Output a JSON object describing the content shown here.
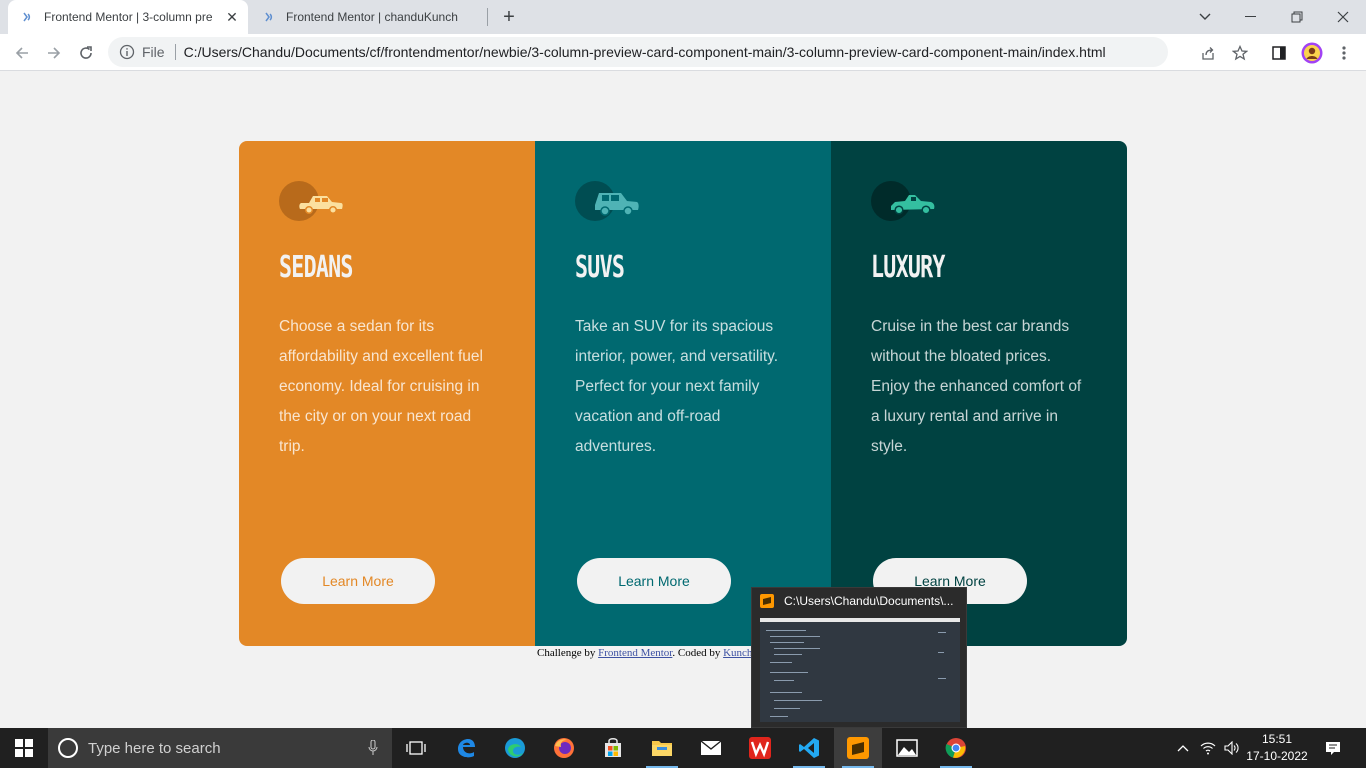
{
  "browser": {
    "tabs": [
      {
        "title": "Frontend Mentor | 3-column pre"
      },
      {
        "title": "Frontend Mentor | chanduKunch"
      }
    ],
    "url_scheme": "File",
    "url": "C:/Users/Chandu/Documents/cf/frontendmentor/newbie/3-column-preview-card-component-main/3-column-preview-card-component-main/index.html"
  },
  "cards": [
    {
      "title": "SEDANS",
      "text": "Choose a sedan for its affordability and excellent fuel economy. Ideal for cruising in the city or on your next road trip.",
      "button": "Learn More",
      "color": "#e38826",
      "icon": "sedan-icon"
    },
    {
      "title": "SUVS",
      "text": "Take an SUV for its spacious interior, power, and versatility. Perfect for your next family vacation and off-road adventures.",
      "button": "Learn More",
      "color": "#006970",
      "icon": "suv-icon"
    },
    {
      "title": "LUXURY",
      "text": "Cruise in the best car brands without the bloated prices. Enjoy the enhanced comfort of a luxury rental and arrive in style.",
      "button": "Learn More",
      "color": "#004241",
      "icon": "luxury-car-icon"
    }
  ],
  "credit": {
    "prefix": "Challenge by ",
    "link1": "Frontend Mentor",
    "middle": ". Coded by ",
    "link2": "Kunch"
  },
  "preview": {
    "title": "C:\\Users\\Chandu\\Documents\\..."
  },
  "taskbar": {
    "search_placeholder": "Type here to search",
    "time": "15:51",
    "date": "17-10-2022"
  }
}
